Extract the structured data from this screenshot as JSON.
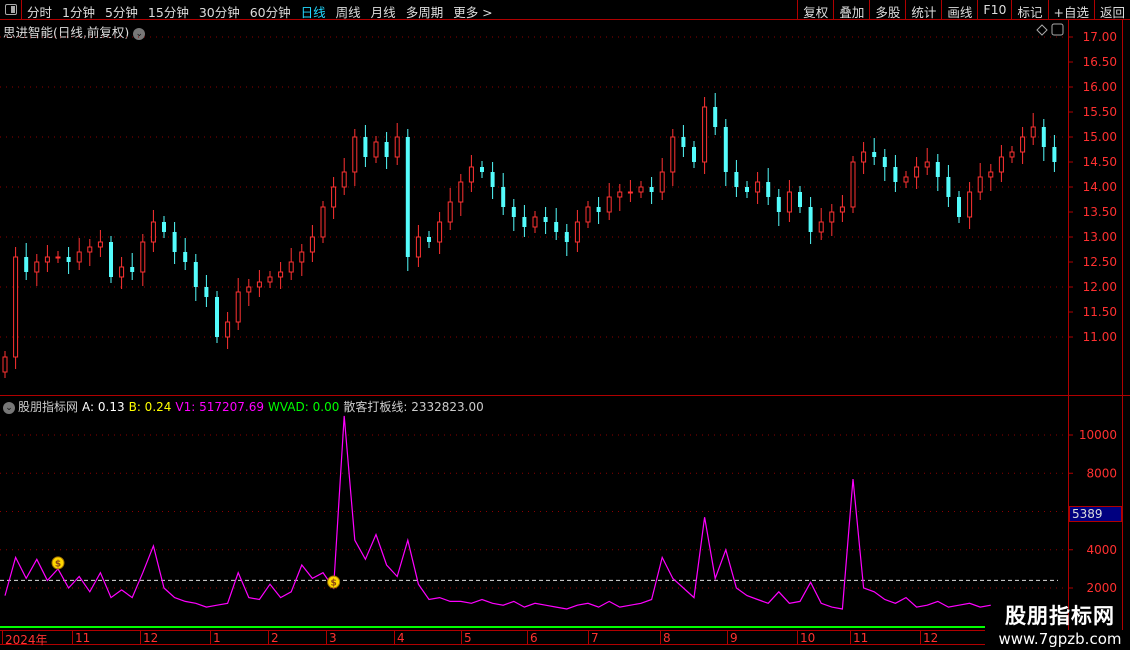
{
  "toolbar": {
    "periods": [
      "分时",
      "1分钟",
      "5分钟",
      "15分钟",
      "30分钟",
      "60分钟",
      "日线",
      "周线",
      "月线",
      "多周期",
      "更多 >"
    ],
    "active_period": "日线",
    "tools": [
      "复权",
      "叠加",
      "多股",
      "统计",
      "画线",
      "F10",
      "标记",
      "+自选",
      "返回"
    ]
  },
  "main_chart": {
    "title": "思进智能(日线,前复权)",
    "y_ticks": [
      "17.00",
      "16.50",
      "16.00",
      "15.50",
      "15.00",
      "14.50",
      "14.00",
      "13.50",
      "13.00",
      "12.50",
      "12.00",
      "11.50",
      "11.00"
    ]
  },
  "indicator": {
    "name": "股朋指标网",
    "items": [
      {
        "label": "A: 0.13",
        "color": "#ffffff"
      },
      {
        "label": "B: 0.24",
        "color": "#ffff00"
      },
      {
        "label": "V1: 517207.69",
        "color": "#ff00ff"
      },
      {
        "label": "WVAD: 0.00",
        "color": "#00ff00"
      },
      {
        "label": "散客打板线: 2332823.00",
        "color": "#cccccc"
      }
    ],
    "y_ticks": [
      "10000",
      "8000",
      "4000",
      "2000"
    ],
    "current_value": "5389"
  },
  "date_axis": [
    "2024年",
    "11",
    "12",
    "1",
    "2",
    "3",
    "4",
    "5",
    "6",
    "7",
    "8",
    "9",
    "10",
    "11",
    "12"
  ],
  "watermark": {
    "title": "股朋指标网",
    "url": "www.7gpzb.com"
  },
  "colors": {
    "up": "#ff3232",
    "down": "#54fcfc",
    "line": "#ff00ff",
    "accent": "#b00000"
  },
  "chart_data": {
    "type": "candlestick+line",
    "price_range": [
      10.3,
      17.3
    ],
    "closes": [
      10.6,
      12.6,
      12.3,
      12.5,
      12.6,
      12.6,
      12.5,
      12.7,
      12.8,
      12.9,
      12.2,
      12.4,
      12.3,
      12.9,
      13.3,
      13.1,
      12.7,
      12.5,
      12.0,
      11.8,
      11.0,
      11.3,
      11.9,
      12.0,
      12.1,
      12.2,
      12.3,
      12.5,
      12.7,
      13.0,
      13.6,
      14.0,
      14.3,
      15.0,
      14.6,
      14.9,
      14.6,
      15.0,
      12.6,
      13.0,
      12.9,
      13.3,
      13.7,
      14.1,
      14.4,
      14.3,
      14.0,
      13.6,
      13.4,
      13.2,
      13.4,
      13.3,
      13.1,
      12.9,
      13.3,
      13.6,
      13.5,
      13.8,
      13.9,
      13.9,
      14.0,
      13.9,
      14.3,
      15.0,
      14.8,
      14.5,
      15.6,
      15.2,
      14.3,
      14.0,
      13.9,
      14.1,
      13.8,
      13.5,
      13.9,
      13.6,
      13.1,
      13.3,
      13.5,
      13.6,
      14.5,
      14.7,
      14.6,
      14.4,
      14.1,
      14.2,
      14.4,
      14.5,
      14.2,
      13.8,
      13.4,
      13.9,
      14.2,
      14.3,
      14.6,
      14.7,
      15.0,
      15.2,
      14.8,
      14.5
    ],
    "indicator_values": [
      1600,
      3600,
      2500,
      3500,
      2400,
      3000,
      2000,
      2600,
      1800,
      2800,
      1500,
      1900,
      1500,
      2800,
      4200,
      2000,
      1500,
      1300,
      1200,
      1000,
      1100,
      1200,
      2800,
      1500,
      1400,
      2200,
      1500,
      1800,
      3200,
      2500,
      2800,
      2000,
      11000,
      4500,
      3500,
      4800,
      3200,
      2600,
      4500,
      2200,
      1400,
      1500,
      1300,
      1300,
      1200,
      1400,
      1200,
      1100,
      1300,
      1000,
      1200,
      1100,
      1000,
      900,
      1100,
      1200,
      1000,
      1300,
      1000,
      1100,
      1200,
      1400,
      3600,
      2500,
      2000,
      1500,
      5700,
      2500,
      4000,
      2000,
      1600,
      1400,
      1200,
      1800,
      1200,
      1300,
      2300,
      1200,
      1000,
      900,
      7700,
      2000,
      1800,
      1400,
      1200,
      1500,
      1000,
      1100,
      1300,
      1000,
      1100,
      1200,
      1000,
      1100
    ],
    "indicator_range": [
      0,
      11500
    ],
    "threshold_line": 2400,
    "signal_markers": [
      5,
      31
    ]
  }
}
